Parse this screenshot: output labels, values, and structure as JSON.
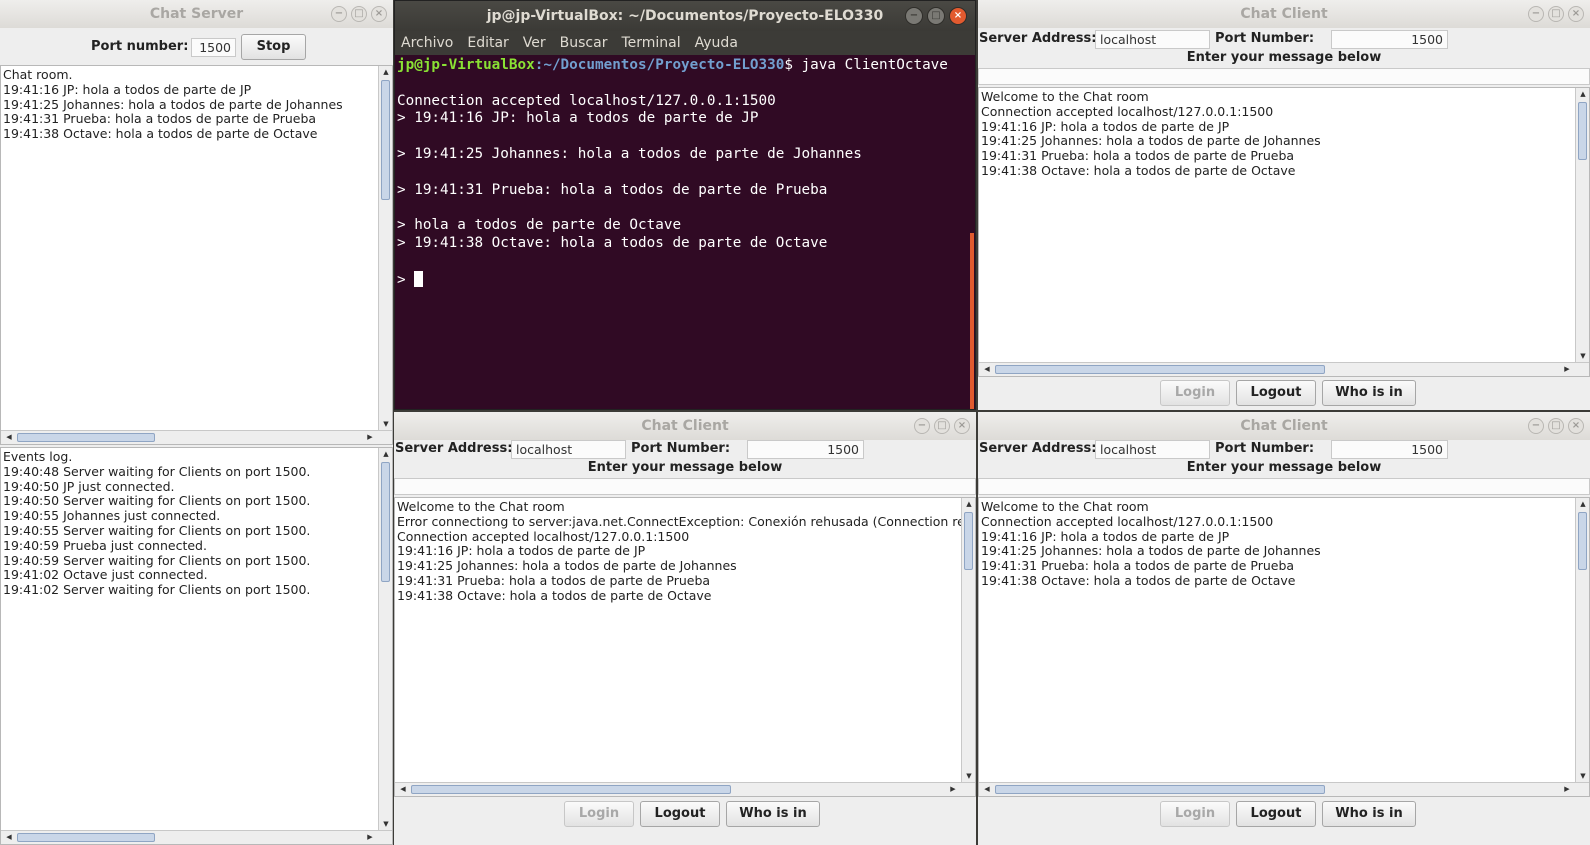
{
  "server": {
    "title": "Chat Server",
    "port_label": "Port number:",
    "port_value": "1500",
    "stop_label": "Stop",
    "chat_lines": [
      "Chat room.",
      "19:41:16 JP: hola a todos de parte de JP",
      "19:41:25 Johannes: hola a todos de parte de Johannes",
      "19:41:31 Prueba: hola a todos de parte de Prueba",
      "19:41:38 Octave: hola a todos de parte de Octave"
    ],
    "event_lines": [
      "Events log.",
      "19:40:48 Server waiting for Clients on port 1500.",
      "19:40:50 JP just connected.",
      "19:40:50 Server waiting for Clients on port 1500.",
      "19:40:55 Johannes just connected.",
      "19:40:55 Server waiting for Clients on port 1500.",
      "19:40:59 Prueba just connected.",
      "19:40:59 Server waiting for Clients on port 1500.",
      "19:41:02 Octave just connected.",
      "19:41:02 Server waiting for Clients on port 1500."
    ]
  },
  "terminal": {
    "title": "jp@jp-VirtualBox: ~/Documentos/Proyecto-ELO330",
    "menu": [
      "Archivo",
      "Editar",
      "Ver",
      "Buscar",
      "Terminal",
      "Ayuda"
    ],
    "prompt_user": "jp@jp-VirtualBox",
    "prompt_path": ":~/Documentos/Proyecto-ELO330",
    "prompt_cmd": "$ java ClientOctave",
    "lines": [
      "",
      "Connection accepted localhost/127.0.0.1:1500",
      "> 19:41:16 JP: hola a todos de parte de JP",
      "",
      "> 19:41:25 Johannes: hola a todos de parte de Johannes",
      "",
      "> 19:41:31 Prueba: hola a todos de parte de Prueba",
      "",
      "> hola a todos de parte de Octave",
      "> 19:41:38 Octave: hola a todos de parte de Octave",
      ""
    ],
    "last_prompt": "> "
  },
  "client_common": {
    "title": "Chat Client",
    "server_label": "Server Address:",
    "server_value": "localhost",
    "port_label": "Port Number:",
    "port_value": "1500",
    "enter_label": "Enter your message below",
    "login_label": "Login",
    "logout_label": "Logout",
    "whoisin_label": "Who is in"
  },
  "client_top_right": {
    "lines": [
      "Welcome to the Chat room",
      "Connection accepted localhost/127.0.0.1:1500",
      "19:41:16 JP: hola a todos de parte de JP",
      "19:41:25 Johannes: hola a todos de parte de Johannes",
      "19:41:31 Prueba: hola a todos de parte de Prueba",
      "19:41:38 Octave: hola a todos de parte de Octave"
    ]
  },
  "client_bottom_middle": {
    "lines": [
      "Welcome to the Chat room",
      "Error connectiong to server:java.net.ConnectException: Conexión rehusada (Connection refuse",
      "Connection accepted localhost/127.0.0.1:1500",
      "19:41:16 JP: hola a todos de parte de JP",
      "19:41:25 Johannes: hola a todos de parte de Johannes",
      "19:41:31 Prueba: hola a todos de parte de Prueba",
      "19:41:38 Octave: hola a todos de parte de Octave"
    ]
  },
  "client_bottom_right": {
    "lines": [
      "Welcome to the Chat room",
      "Connection accepted localhost/127.0.0.1:1500",
      "19:41:16 JP: hola a todos de parte de JP",
      "19:41:25 Johannes: hola a todos de parte de Johannes",
      "19:41:31 Prueba: hola a todos de parte de Prueba",
      "19:41:38 Octave: hola a todos de parte de Octave"
    ]
  },
  "window_buttons": {
    "minimize": "−",
    "maximize": "□",
    "close": "×"
  }
}
